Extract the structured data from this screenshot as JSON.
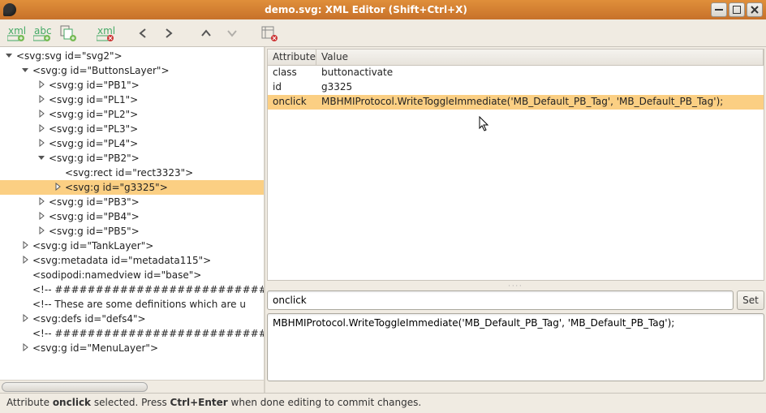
{
  "window": {
    "title": "demo.svg: XML Editor (Shift+Ctrl+X)"
  },
  "toolbar_icons": {
    "new_element_node": "new-element-node",
    "new_text_node": "new-text-node",
    "duplicate_node": "duplicate-node",
    "delete_node": "delete-node",
    "nav_prev": "prev",
    "nav_next": "next",
    "nav_up": "up",
    "nav_down": "down",
    "collapse_pane": "collapse"
  },
  "tree": [
    {
      "depth": 0,
      "exp": "down",
      "text": "<svg:svg id=\"svg2\">"
    },
    {
      "depth": 1,
      "exp": "down",
      "text": "<svg:g id=\"ButtonsLayer\">"
    },
    {
      "depth": 2,
      "exp": "right",
      "text": "<svg:g id=\"PB1\">"
    },
    {
      "depth": 2,
      "exp": "right",
      "text": "<svg:g id=\"PL1\">"
    },
    {
      "depth": 2,
      "exp": "right",
      "text": "<svg:g id=\"PL2\">"
    },
    {
      "depth": 2,
      "exp": "right",
      "text": "<svg:g id=\"PL3\">"
    },
    {
      "depth": 2,
      "exp": "right",
      "text": "<svg:g id=\"PL4\">"
    },
    {
      "depth": 2,
      "exp": "down",
      "text": "<svg:g id=\"PB2\">"
    },
    {
      "depth": 3,
      "exp": "none",
      "text": "<svg:rect id=\"rect3323\">"
    },
    {
      "depth": 3,
      "exp": "right",
      "text": "<svg:g id=\"g3325\">",
      "selected": true
    },
    {
      "depth": 2,
      "exp": "right",
      "text": "<svg:g id=\"PB3\">"
    },
    {
      "depth": 2,
      "exp": "right",
      "text": "<svg:g id=\"PB4\">"
    },
    {
      "depth": 2,
      "exp": "right",
      "text": "<svg:g id=\"PB5\">"
    },
    {
      "depth": 1,
      "exp": "right",
      "text": "<svg:g id=\"TankLayer\">"
    },
    {
      "depth": 1,
      "exp": "right",
      "text": "<svg:metadata id=\"metadata115\">"
    },
    {
      "depth": 1,
      "exp": "none",
      "text": "<sodipodi:namedview id=\"base\">"
    },
    {
      "depth": 1,
      "exp": "none",
      "text": "<!-- ################################"
    },
    {
      "depth": 1,
      "exp": "none",
      "text": "<!-- These are some definitions which are u"
    },
    {
      "depth": 1,
      "exp": "right",
      "text": "<svg:defs id=\"defs4\">"
    },
    {
      "depth": 1,
      "exp": "none",
      "text": "<!-- ################################"
    },
    {
      "depth": 1,
      "exp": "right",
      "text": "<svg:g id=\"MenuLayer\">"
    }
  ],
  "attributes": {
    "header": {
      "name": "Attribute",
      "value": "Value"
    },
    "rows": [
      {
        "name": "class",
        "value": "buttonactivate"
      },
      {
        "name": "id",
        "value": "g3325"
      },
      {
        "name": "onclick",
        "value": "MBHMIProtocol.WriteToggleImmediate('MB_Default_PB_Tag', 'MB_Default_PB_Tag');",
        "selected": true
      }
    ]
  },
  "edit": {
    "name_value": "onclick",
    "set_label": "Set",
    "value_text": "MBHMIProtocol.WriteToggleImmediate('MB_Default_PB_Tag', 'MB_Default_PB_Tag');"
  },
  "statusbar": {
    "prefix": "Attribute ",
    "attr": "onclick",
    "middle": " selected. Press ",
    "key": "Ctrl+Enter",
    "suffix": " when done editing to commit changes."
  }
}
